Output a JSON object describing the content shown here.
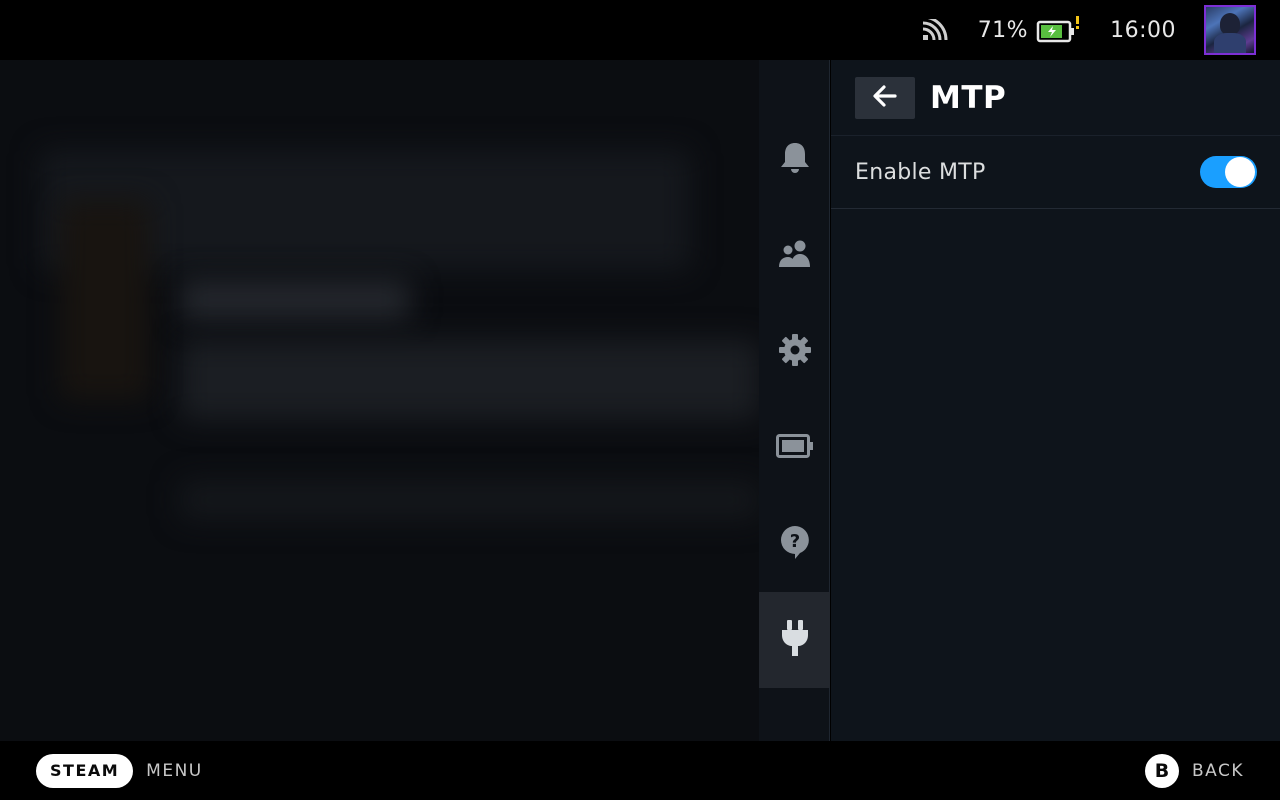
{
  "status_bar": {
    "battery_percent": "71%",
    "clock": "16:00",
    "icons": [
      "wifi-icon",
      "battery-charging-icon",
      "avatar"
    ]
  },
  "sidebar": {
    "items": [
      {
        "icon": "bell-icon",
        "active": false
      },
      {
        "icon": "friends-icon",
        "active": false
      },
      {
        "icon": "gear-icon",
        "active": false
      },
      {
        "icon": "battery-icon",
        "active": false
      },
      {
        "icon": "help-icon",
        "active": false
      },
      {
        "icon": "plug-icon",
        "active": true
      }
    ]
  },
  "panel": {
    "title": "MTP",
    "settings": [
      {
        "label": "Enable MTP",
        "enabled": true
      }
    ]
  },
  "bottom_bar": {
    "steam_label": "STEAM",
    "menu_label": "MENU",
    "b_button": "B",
    "back_label": "BACK"
  },
  "colors": {
    "accent": "#1a9fff",
    "panel_bg": "#0e141b",
    "active_item_bg": "#23272e"
  }
}
